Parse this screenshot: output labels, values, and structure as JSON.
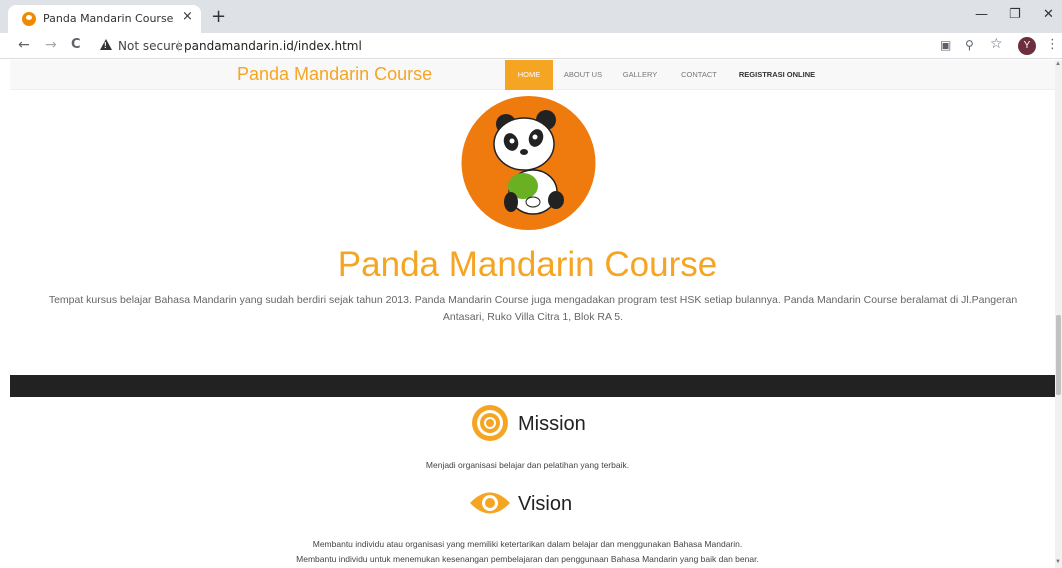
{
  "browser": {
    "tab_title": "Panda Mandarin Course",
    "tab_close": "×",
    "new_tab": "+",
    "minimize": "—",
    "restore": "❐",
    "close": "✕",
    "back": "←",
    "forward": "→",
    "reload": "C",
    "security_label": "Not secure",
    "url": "pandamandarin.id/index.html",
    "translate_icon": "▣",
    "zoom_icon": "⚲",
    "bookmark_icon": "☆",
    "profile_initial": "Y",
    "menu_icon": "⋮"
  },
  "navbar": {
    "brand": "Panda Mandarin Course",
    "items": [
      {
        "label": "HOME",
        "active": true
      },
      {
        "label": "ABOUT US"
      },
      {
        "label": "GALLERY"
      },
      {
        "label": "CONTACT"
      },
      {
        "label": "REGISTRASI ONLINE",
        "bold": true
      }
    ]
  },
  "hero": {
    "title": "Panda Mandarin Course",
    "description_line1": "Tempat kursus belajar Bahasa Mandarin yang sudah berdiri sejak tahun 2013. Panda Mandarin Course juga mengadakan program test HSK setiap bulannya. Panda Mandarin Course beralamat di Jl.Pangeran",
    "description_line2": "Antasari, Ruko Villa Citra 1, Blok RA 5."
  },
  "mission": {
    "title": "Mission",
    "text": "Menjadi organisasi belajar dan pelatihan yang terbaik."
  },
  "vision": {
    "title": "Vision",
    "text_line1": "Membantu individu atau organisasi yang memiliki ketertarikan dalam belajar dan menggunakan Bahasa Mandarin.",
    "text_line2": "Membantu individu untuk menemukan kesenangan pembelajaran dan penggunaan Bahasa Mandarin yang baik dan benar."
  },
  "colors": {
    "accent": "#f5a522",
    "logo_bg": "#ef7b0e",
    "dark_band": "#222222"
  }
}
